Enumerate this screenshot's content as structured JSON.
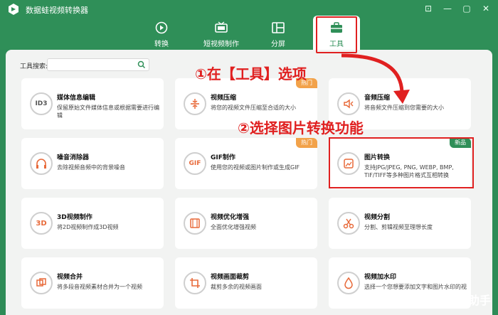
{
  "app": {
    "title": "数据蛙视频转换器",
    "window_controls": [
      "⊡",
      "—",
      "▢",
      "✕"
    ]
  },
  "tabs": [
    {
      "label": "转换",
      "icon": "disc-play-icon"
    },
    {
      "label": "短视频制作",
      "icon": "tv-icon"
    },
    {
      "label": "分屏",
      "icon": "split-screen-icon"
    },
    {
      "label": "工具",
      "icon": "toolbox-icon"
    }
  ],
  "search": {
    "label": "工具搜索:",
    "placeholder": ""
  },
  "cards": [
    {
      "title": "媒体信息编辑",
      "desc": "保留原始文件媒体信息或根据需要进行编辑",
      "badge": "",
      "icon": "id3-icon",
      "icon_text": "ID3"
    },
    {
      "title": "视频压缩",
      "desc": "将您的视频文件压缩至合适的大小",
      "badge": "热门",
      "icon": "compress-icon",
      "icon_text": ""
    },
    {
      "title": "音频压缩",
      "desc": "将音频文件压缩到您需要的大小",
      "badge": "",
      "icon": "audio-compress-icon",
      "icon_text": ""
    },
    {
      "title": "噪音消除器",
      "desc": "去除视频音频中的背景噪音",
      "badge": "",
      "icon": "headphones-icon",
      "icon_text": ""
    },
    {
      "title": "GIF制作",
      "desc": "使用您的视频或图片制作或生成GIF",
      "badge": "热门",
      "icon": "gif-icon",
      "icon_text": "GIF"
    },
    {
      "title": "图片转换",
      "desc": "支持JPG/JPEG, PNG, WEBP, BMP, TIF/TIFF等多种图片格式互相转换",
      "badge": "新品",
      "icon": "image-convert-icon",
      "icon_text": ""
    },
    {
      "title": "3D视频制作",
      "desc": "将2D视频制作成3D视频",
      "badge": "",
      "icon": "3d-icon",
      "icon_text": "3D"
    },
    {
      "title": "视频优化增强",
      "desc": "全面优化增强视频",
      "badge": "",
      "icon": "film-enhance-icon",
      "icon_text": ""
    },
    {
      "title": "视频分割",
      "desc": "分割、剪辑视频至理想长度",
      "badge": "",
      "icon": "scissors-icon",
      "icon_text": ""
    },
    {
      "title": "视频合并",
      "desc": "将多段音视频素材合并为一个视频",
      "badge": "",
      "icon": "merge-icon",
      "icon_text": ""
    },
    {
      "title": "视频画面裁剪",
      "desc": "裁剪多余的视频画面",
      "badge": "",
      "icon": "crop-icon",
      "icon_text": ""
    },
    {
      "title": "视频加水印",
      "desc": "选择一个您想要添加文字和图片水印的视",
      "badge": "",
      "icon": "droplet-icon",
      "icon_text": ""
    }
  ],
  "annotations": {
    "step1": "①在【工具】选项",
    "step2": "②选择图片转换功能"
  },
  "watermark": "掘金技术社区 @ 小明助手",
  "colors": {
    "brand_green": "#2f8f58",
    "hot_orange": "#f2a24a",
    "annot_red": "#e02020"
  }
}
